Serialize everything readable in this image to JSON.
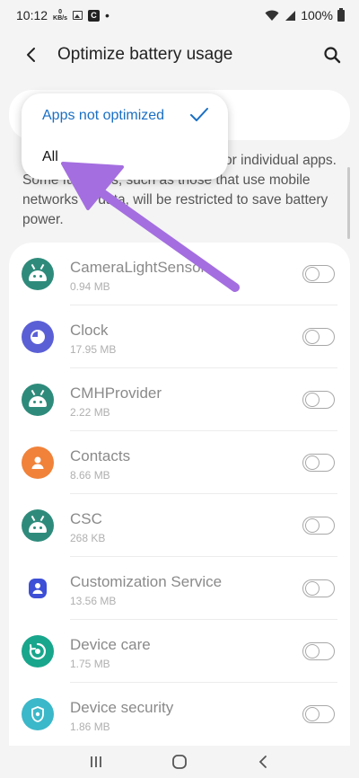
{
  "status": {
    "time": "10:12",
    "kbs_value": "0",
    "kbs_unit": "KB/s",
    "c_badge": "C",
    "dot": "•",
    "battery": "100%"
  },
  "header": {
    "title": "Optimize battery usage"
  },
  "dropdown": {
    "options": [
      {
        "label": "Apps not optimized",
        "selected": true
      },
      {
        "label": "All",
        "selected": false
      }
    ]
  },
  "description": {
    "text": "Some functions, such as those that use mobile networks or data, will be restricted to save battery power.",
    "visible_line1_tail": "or individual apps."
  },
  "apps": [
    {
      "name": "CameraLightSensor",
      "size": "0.94 MB",
      "icon": "android-icon",
      "color": "#2e8b7b"
    },
    {
      "name": "Clock",
      "size": "17.95 MB",
      "icon": "clock-icon",
      "color": "#5b5fd6"
    },
    {
      "name": "CMHProvider",
      "size": "2.22 MB",
      "icon": "android-icon",
      "color": "#2e8b7b"
    },
    {
      "name": "Contacts",
      "size": "8.66 MB",
      "icon": "contacts-icon",
      "color": "#f0823a"
    },
    {
      "name": "CSC",
      "size": "268 KB",
      "icon": "android-icon",
      "color": "#2e8b7b"
    },
    {
      "name": "Customization Service",
      "size": "13.56 MB",
      "icon": "customization-icon",
      "color": "#3d4fd6"
    },
    {
      "name": "Device care",
      "size": "1.75 MB",
      "icon": "device-care-icon",
      "color": "#18a68c"
    },
    {
      "name": "Device security",
      "size": "1.86 MB",
      "icon": "device-security-icon",
      "color": "#3bb8c9"
    }
  ],
  "colors": {
    "accent": "#1a6fc4",
    "arrow": "#a46ee0"
  }
}
